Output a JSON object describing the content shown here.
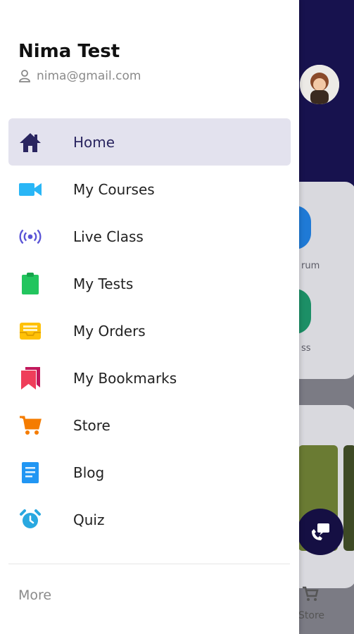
{
  "user": {
    "name": "Nima Test",
    "email": "nima@gmail.com"
  },
  "menu": {
    "items": [
      {
        "label": "Home",
        "icon": "home-icon",
        "color": "#2a2560",
        "active": true
      },
      {
        "label": "My Courses",
        "icon": "video-camera-icon",
        "color": "#29b6f6",
        "active": false
      },
      {
        "label": "Live Class",
        "icon": "broadcast-icon",
        "color": "#5a54d6",
        "active": false
      },
      {
        "label": "My Tests",
        "icon": "clipboard-icon",
        "color": "#22c55e",
        "active": false
      },
      {
        "label": "My Orders",
        "icon": "inbox-tray-icon",
        "color": "#ffc107",
        "active": false
      },
      {
        "label": "My Bookmarks",
        "icon": "bookmarks-icon",
        "color": "#ef3e5a",
        "active": false
      },
      {
        "label": "Store",
        "icon": "cart-icon",
        "color": "#f57c00",
        "active": false
      },
      {
        "label": "Blog",
        "icon": "document-icon",
        "color": "#2196f3",
        "active": false
      },
      {
        "label": "Quiz",
        "icon": "alarm-clock-icon",
        "color": "#29a8e0",
        "active": false
      }
    ]
  },
  "footer": {
    "more_label": "More"
  },
  "background": {
    "label_forum": "rum",
    "label_class": "ss",
    "label_store": "Store"
  },
  "colors": {
    "header_bg": "#17124e",
    "active_bg": "#e3e2ee"
  }
}
